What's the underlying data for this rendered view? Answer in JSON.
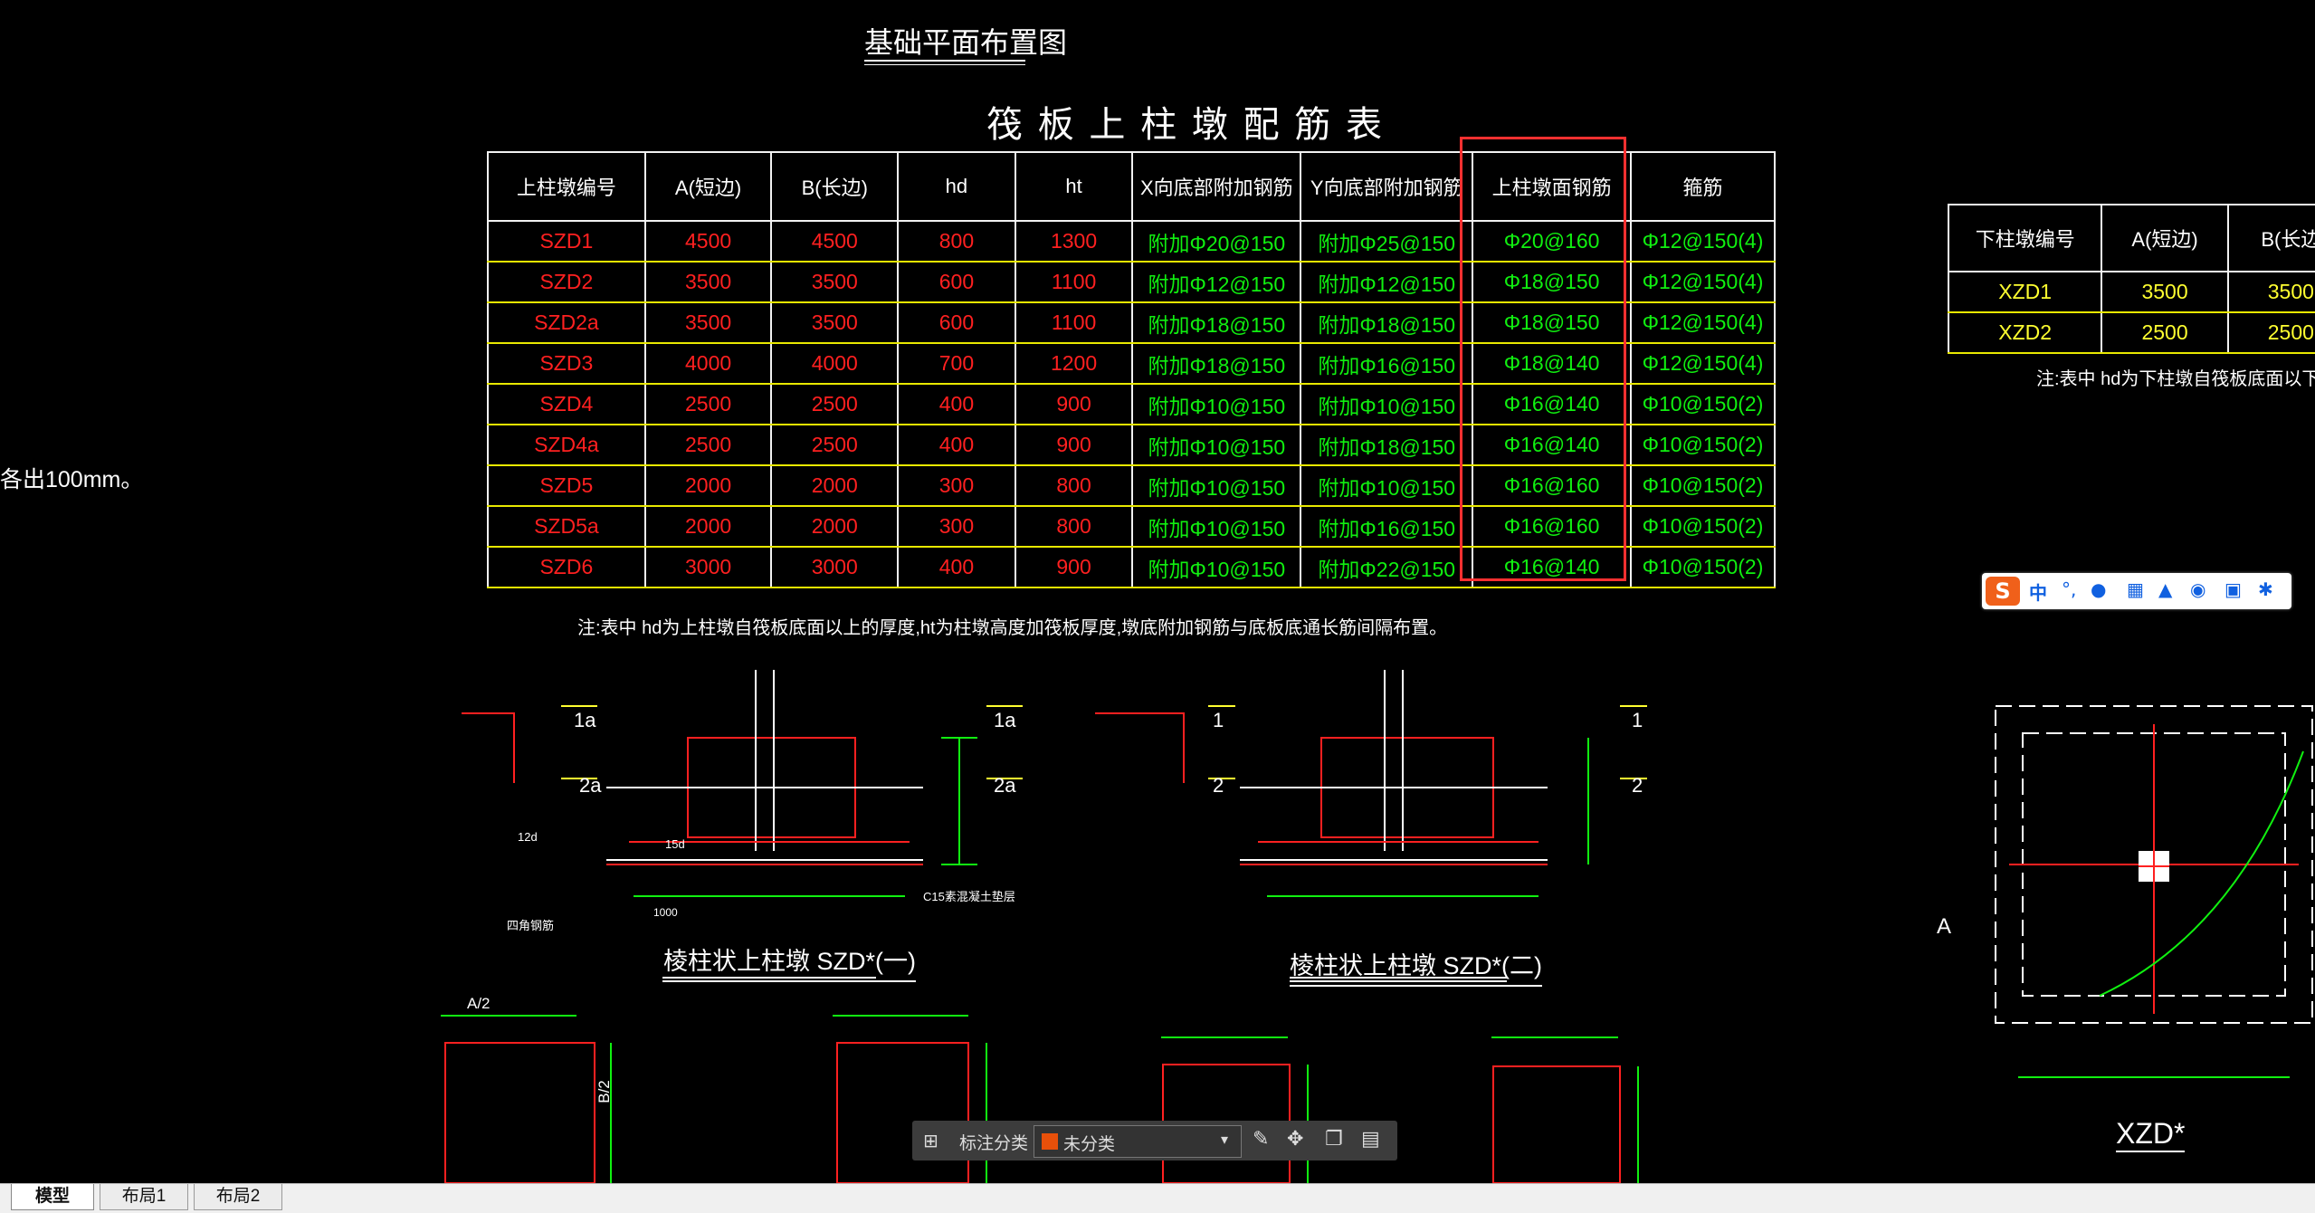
{
  "drawing": {
    "plan_title": "基础平面布置图",
    "table_title": "筏 板 上 柱 墩 配 筋 表",
    "left_note": "各出100mm。",
    "table_note": "注:表中 hd为上柱墩自筏板底面以上的厚度,ht为柱墩高度加筏板厚度,墩底附加钢筋与底板底通长筋间隔布置。",
    "colors": {
      "red": "#ff2020",
      "green": "#10f010",
      "yellow": "#ffff30",
      "highlight": "#ff3030"
    }
  },
  "upper_table": {
    "headers": [
      "上柱墩编号",
      "A(短边)",
      "B(长边)",
      "hd",
      "ht",
      "X向底部附加钢筋",
      "Y向底部附加钢筋",
      "上柱墩面钢筋",
      "箍筋"
    ],
    "rows": [
      [
        "SZD1",
        "4500",
        "4500",
        "800",
        "1300",
        "附加Φ20@150",
        "附加Φ25@150",
        "Φ20@160",
        "Φ12@150(4)"
      ],
      [
        "SZD2",
        "3500",
        "3500",
        "600",
        "1100",
        "附加Φ12@150",
        "附加Φ12@150",
        "Φ18@150",
        "Φ12@150(4)"
      ],
      [
        "SZD2a",
        "3500",
        "3500",
        "600",
        "1100",
        "附加Φ18@150",
        "附加Φ18@150",
        "Φ18@150",
        "Φ12@150(4)"
      ],
      [
        "SZD3",
        "4000",
        "4000",
        "700",
        "1200",
        "附加Φ18@150",
        "附加Φ16@150",
        "Φ18@140",
        "Φ12@150(4)"
      ],
      [
        "SZD4",
        "2500",
        "2500",
        "400",
        "900",
        "附加Φ10@150",
        "附加Φ10@150",
        "Φ16@140",
        "Φ10@150(2)"
      ],
      [
        "SZD4a",
        "2500",
        "2500",
        "400",
        "900",
        "附加Φ10@150",
        "附加Φ18@150",
        "Φ16@140",
        "Φ10@150(2)"
      ],
      [
        "SZD5",
        "2000",
        "2000",
        "300",
        "800",
        "附加Φ10@150",
        "附加Φ10@150",
        "Φ16@160",
        "Φ10@150(2)"
      ],
      [
        "SZD5a",
        "2000",
        "2000",
        "300",
        "800",
        "附加Φ10@150",
        "附加Φ16@150",
        "Φ16@160",
        "Φ10@150(2)"
      ],
      [
        "SZD6",
        "3000",
        "3000",
        "400",
        "900",
        "附加Φ10@150",
        "附加Φ22@150",
        "Φ16@140",
        "Φ10@150(2)"
      ]
    ]
  },
  "lower_table": {
    "headers": [
      "下柱墩编号",
      "A(短边)",
      "B(长边"
    ],
    "rows": [
      [
        "XZD1",
        "3500",
        "3500"
      ],
      [
        "XZD2",
        "2500",
        "2500"
      ]
    ],
    "note": "注:表中 hd为下柱墩自筏板底面以下的厚度,,ht"
  },
  "details": {
    "detail1_title": "棱柱状上柱墩 SZD*(一)",
    "detail2_title": "棱柱状上柱墩 SZD*(二)",
    "xzd_title": "XZD*",
    "label_1a": "1a",
    "label_2a": "2a",
    "label_1": "1",
    "label_2": "2",
    "label_15d": "15d",
    "label_12d": "12d",
    "label_1000": "1000",
    "label_a2": "A/2",
    "label_b2": "B/2",
    "label_A": "A",
    "label_cut": "四角钢筋",
    "label_c15": "C15素混凝土垫层"
  },
  "annotation_bar": {
    "label": "标注分类",
    "value": "未分类",
    "swatch": "#e8500a"
  },
  "layout_tabs": [
    "模型",
    "布局1",
    "布局2"
  ],
  "ime": {
    "mode": "中"
  }
}
